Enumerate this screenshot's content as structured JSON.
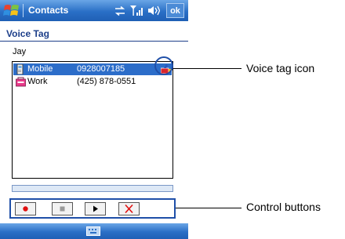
{
  "titlebar": {
    "app_title": "Contacts",
    "ok_label": "ok"
  },
  "page": {
    "title": "Voice Tag",
    "contact_name": "Jay"
  },
  "phones": [
    {
      "type": "Mobile",
      "number": "0928007185",
      "selected": true,
      "has_voice_tag": true
    },
    {
      "type": "Work",
      "number": "(425) 878-0551",
      "selected": false,
      "has_voice_tag": false
    }
  ],
  "controls": {
    "record": "record-icon",
    "stop": "stop-icon",
    "play": "play-icon",
    "delete": "delete-icon"
  },
  "callouts": {
    "voice_tag": "Voice tag icon",
    "control_buttons": "Control buttons"
  },
  "colors": {
    "titlebar": "#2a6fc6",
    "selection": "#2c6dc9",
    "accent": "#1f4fa8"
  }
}
